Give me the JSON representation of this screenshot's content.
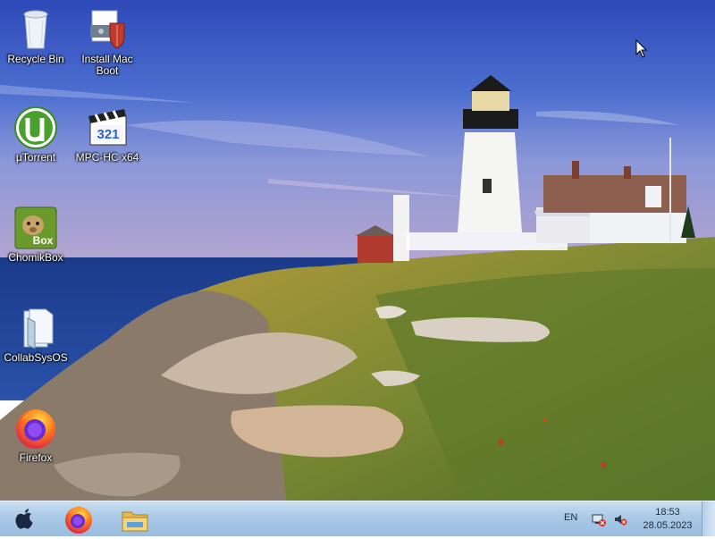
{
  "desktop": {
    "icons": [
      {
        "label": "Recycle Bin",
        "icon": "recycle-bin-icon"
      },
      {
        "label": "Install Mac\nBoot",
        "icon": "installer-shield-icon"
      },
      {
        "label": "µTorrent",
        "icon": "utorrent-icon"
      },
      {
        "label": "MPC-HC x64",
        "icon": "mpc-hc-icon"
      },
      {
        "label": "ChomikBox",
        "icon": "chomikbox-icon"
      },
      {
        "label": "CollabSysOS",
        "icon": "folder-icon"
      },
      {
        "label": "Firefox",
        "icon": "firefox-icon"
      }
    ],
    "mpc_badge": "321",
    "chomik_badge": "Box"
  },
  "taskbar": {
    "pinned": [
      "apple-start-icon",
      "firefox-icon",
      "file-explorer-icon"
    ],
    "language": "EN",
    "time": "18:53",
    "date": "28.05.2023"
  }
}
